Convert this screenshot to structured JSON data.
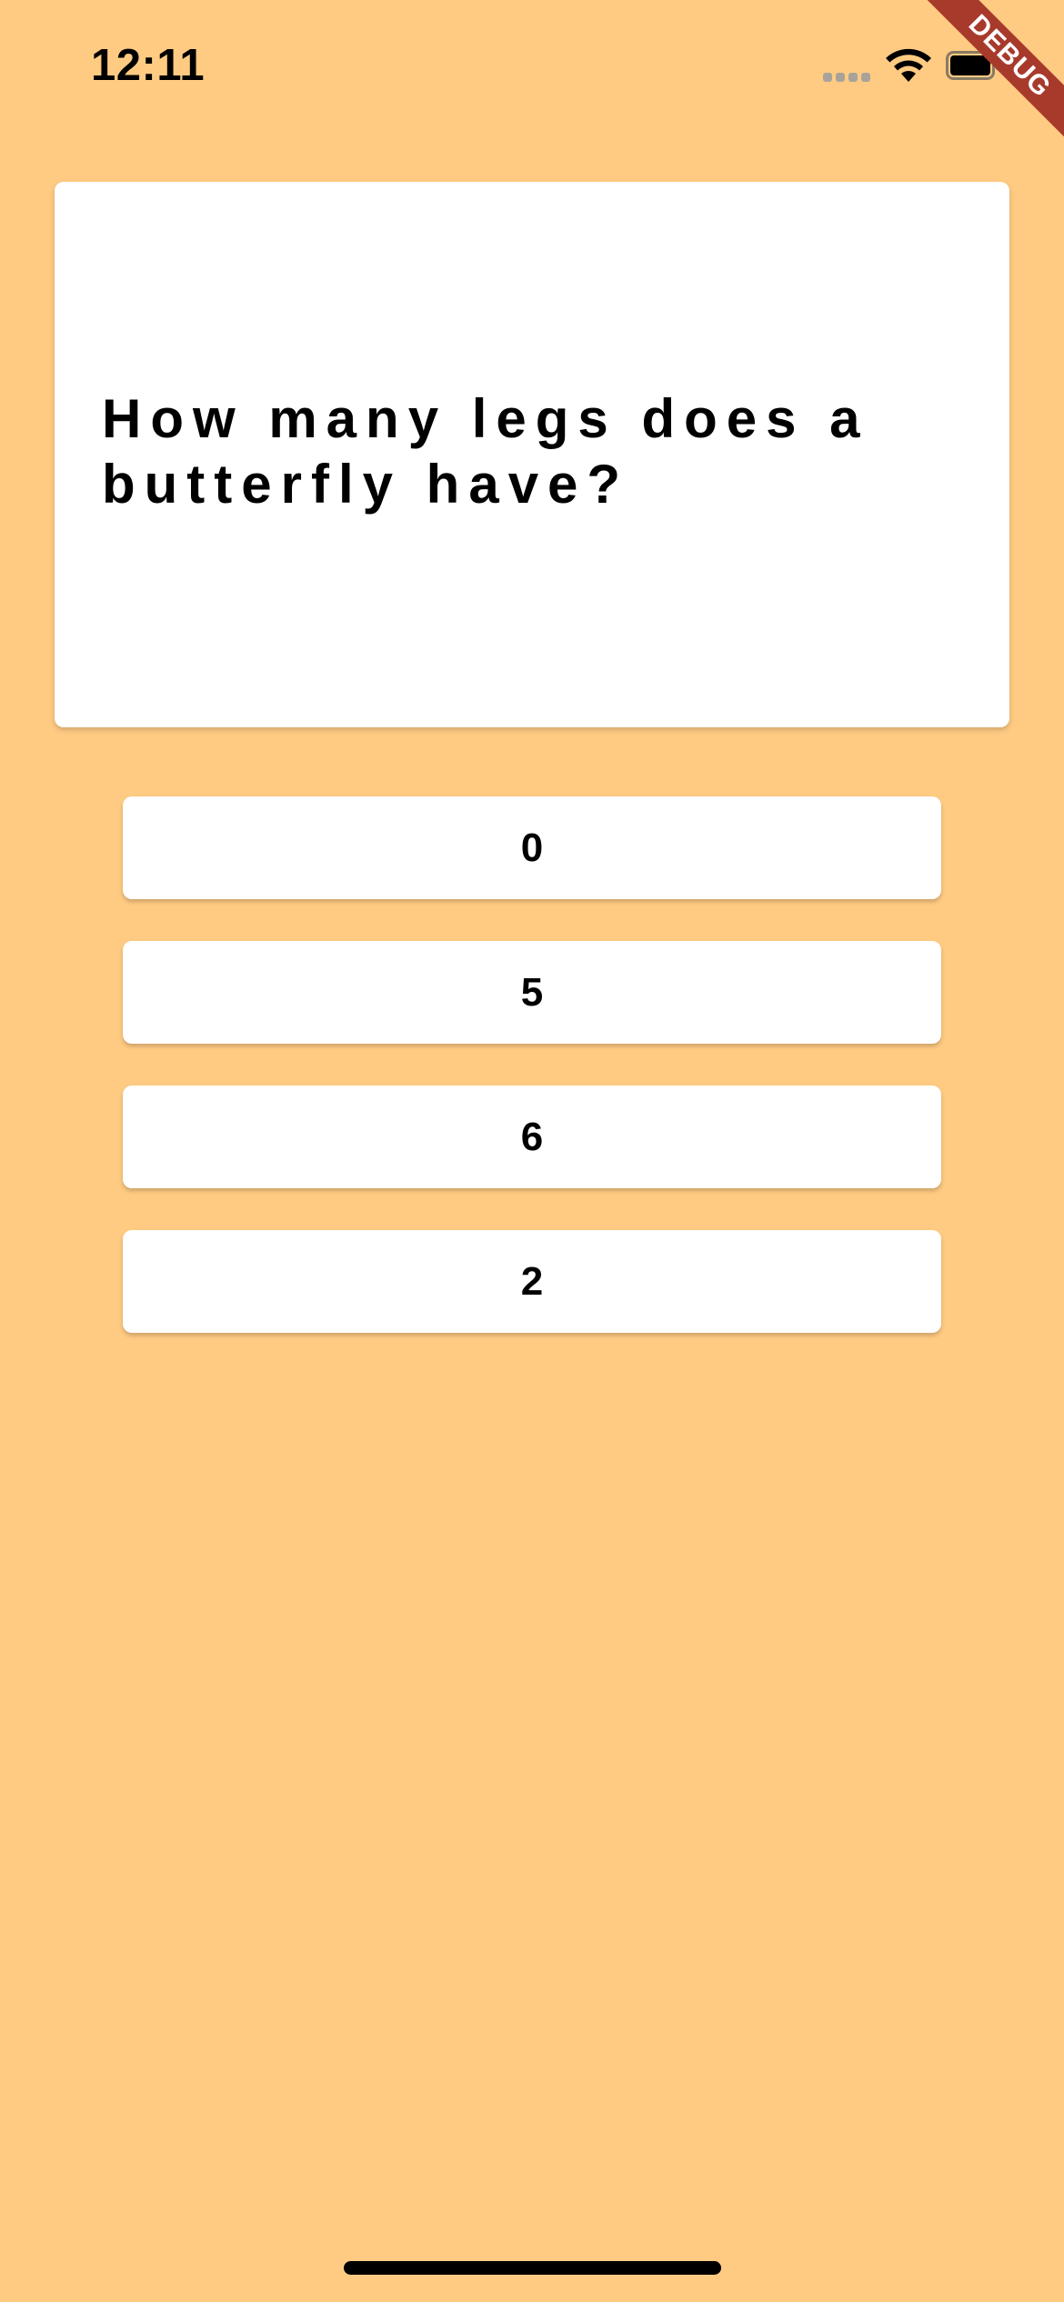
{
  "colors": {
    "background": "#ffcb83",
    "card": "#ffffff",
    "text": "#000000",
    "debug_banner": "#a83a2c"
  },
  "status_bar": {
    "time": "12:11",
    "icons": [
      "cellular-signal-icon",
      "wifi-icon",
      "battery-icon"
    ]
  },
  "debug_banner": {
    "label": "DEBUG"
  },
  "question": {
    "text": "How many legs does a butterfly have?"
  },
  "answers": [
    {
      "label": "0"
    },
    {
      "label": "5"
    },
    {
      "label": "6"
    },
    {
      "label": "2"
    }
  ]
}
